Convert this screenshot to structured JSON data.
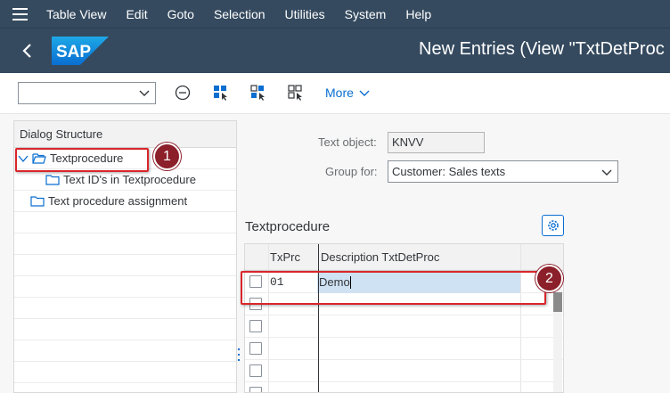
{
  "menubar": {
    "items": [
      "Table View",
      "Edit",
      "Goto",
      "Selection",
      "Utilities",
      "System",
      "Help"
    ],
    "hamburger_icon": "menu-icon"
  },
  "titlebar": {
    "title": "New Entries (View \"TxtDetProc",
    "logo_text": "SAP",
    "background": "#354a5f"
  },
  "toolbar": {
    "command_field_value": "",
    "more_label": "More",
    "icons": [
      "collapse-icon",
      "select-all-icon",
      "deselect-all-icon",
      "select-block-icon"
    ]
  },
  "dialog_structure": {
    "header": "Dialog Structure",
    "items": [
      {
        "label": "Textprocedure",
        "icon": "open-folder-icon",
        "expanded": true
      },
      {
        "label": "Text ID's in Textprocedure",
        "icon": "folder-icon"
      },
      {
        "label": "Text procedure assignment",
        "icon": "folder-icon"
      }
    ]
  },
  "form": {
    "text_object_label": "Text object:",
    "text_object_value": "KNVV",
    "group_label": "Group for:",
    "group_value": "Customer: Sales texts"
  },
  "table": {
    "section_title": "Textprocedure",
    "columns": [
      "TxPrc",
      "Description TxtDetProc"
    ],
    "rows": [
      {
        "txprc": "01",
        "desc": "Demo"
      },
      {
        "txprc": "",
        "desc": ""
      },
      {
        "txprc": "",
        "desc": ""
      },
      {
        "txprc": "",
        "desc": ""
      },
      {
        "txprc": "",
        "desc": ""
      },
      {
        "txprc": "",
        "desc": ""
      }
    ]
  },
  "callouts": [
    "1",
    "2"
  ],
  "colors": {
    "shell": "#354a5f",
    "accent": "#0a6ed1",
    "callout": "#d9262b",
    "badge": "#8b1f2a"
  }
}
